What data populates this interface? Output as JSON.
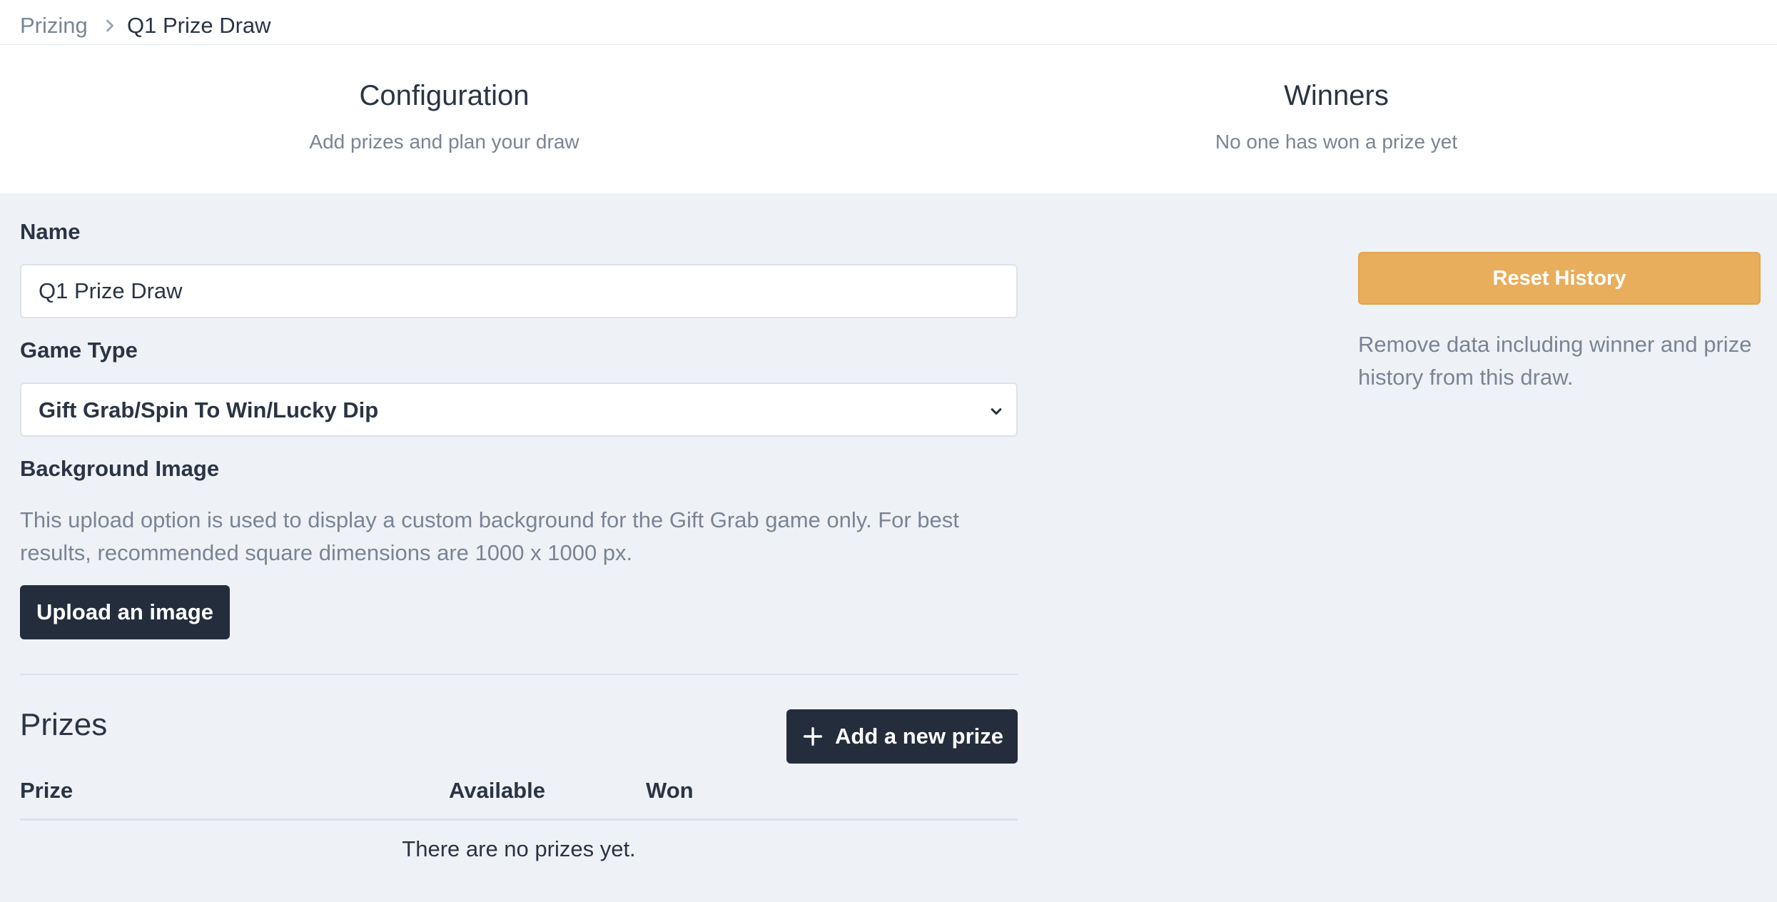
{
  "breadcrumb": {
    "root": "Prizing",
    "current": "Q1 Prize Draw"
  },
  "tabs": [
    {
      "title": "Configuration",
      "subtitle": "Add prizes and plan your draw"
    },
    {
      "title": "Winners",
      "subtitle": "No one has won a prize yet"
    }
  ],
  "form": {
    "name_label": "Name",
    "name_value": "Q1 Prize Draw",
    "game_type_label": "Game Type",
    "game_type_value": "Gift Grab/Spin To Win/Lucky Dip",
    "background_label": "Background Image",
    "background_help": "This upload option is used to display a custom background for the Gift Grab game only. For best results, recommended square dimensions are 1000 x 1000 px.",
    "upload_button": "Upload an image"
  },
  "prizes": {
    "title": "Prizes",
    "add_button": "Add a new prize",
    "columns": [
      "Prize",
      "Available",
      "Won"
    ],
    "empty_text": "There are no prizes yet."
  },
  "reset": {
    "button": "Reset History",
    "help": "Remove data including winner and prize history from this draw."
  },
  "colors": {
    "background": "#eef2f7",
    "dark_button": "#232d3c",
    "reset_button": "#e8ae5c",
    "muted_text": "#7a8494"
  },
  "icons": {
    "breadcrumb_separator": "chevron-right-icon",
    "select_arrow": "chevron-down-icon",
    "add": "plus-icon"
  }
}
